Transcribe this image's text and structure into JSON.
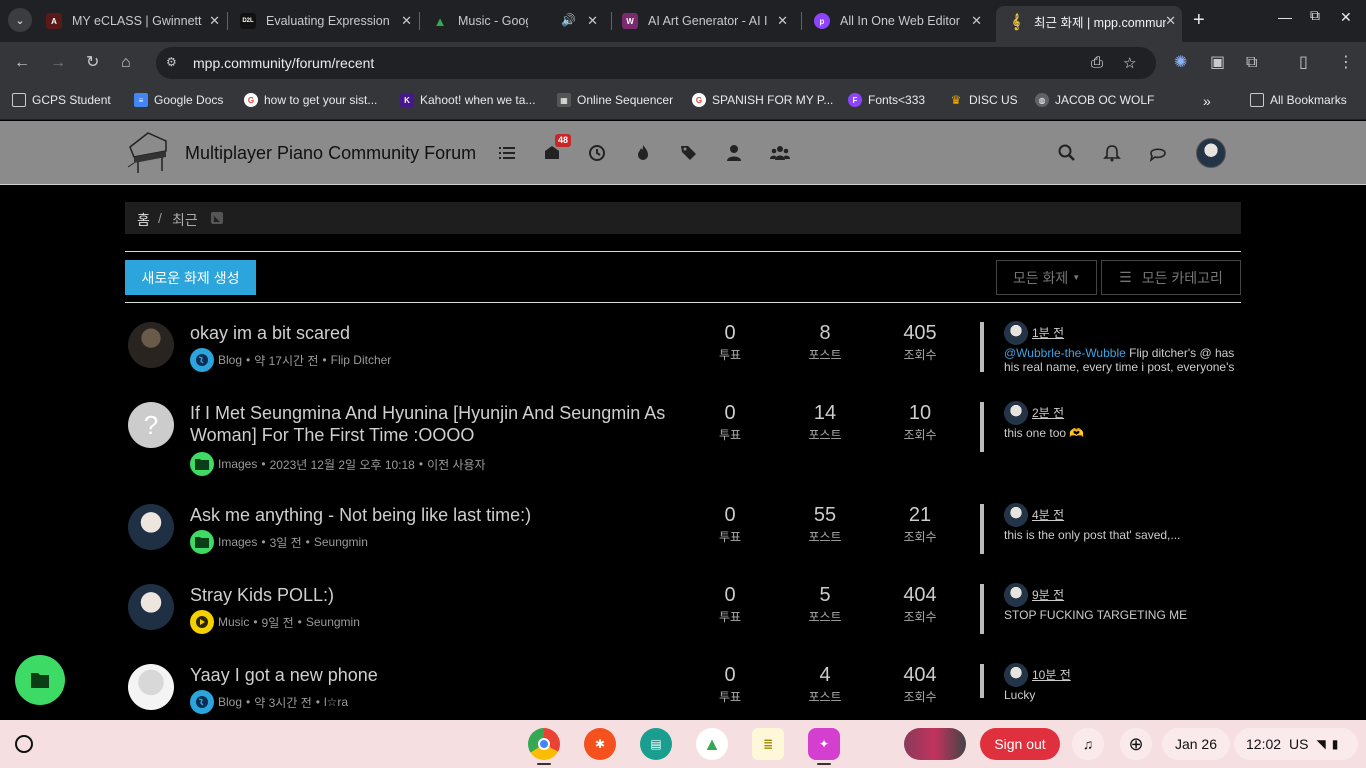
{
  "browser": {
    "tabs": [
      {
        "title": "MY eCLASS | Gwinnett",
        "fav_color": "#5a1a1a",
        "fav_text": "A"
      },
      {
        "title": "Evaluating Expression",
        "fav_color": "#111111",
        "fav_text": "D2L"
      },
      {
        "title": "Music - Google Drive",
        "fav_color": "#1e8e3e",
        "fav_text": "▲"
      },
      {
        "title": "AI Art Generator - AI Im",
        "fav_color": "#7a2b6e",
        "fav_text": "W"
      },
      {
        "title": "All In One Web Editor |",
        "fav_color": "#8e44ff",
        "fav_text": "p"
      },
      {
        "title": "최근 화제 | mpp.community",
        "fav_color": "#35363a",
        "fav_text": "𝄞"
      }
    ],
    "url": "mpp.community/forum/recent",
    "bookmarks": [
      {
        "label": "GCPS Student",
        "color": "#5f6368"
      },
      {
        "label": "Google Docs",
        "color": "#4285f4"
      },
      {
        "label": "how to get your sist...",
        "color": "#ea4335"
      },
      {
        "label": "Kahoot! when we ta...",
        "color": "#46178f"
      },
      {
        "label": "Online Sequencer",
        "color": "#555555"
      },
      {
        "label": "SPANISH FOR MY P...",
        "color": "#ea4335"
      },
      {
        "label": "Fonts<333",
        "color": "#8e44ff"
      },
      {
        "label": "DISC US",
        "color": "#f9ab00"
      },
      {
        "label": "JACOB OC WOLF",
        "color": "#5f6368"
      }
    ],
    "all_bookmarks": "All Bookmarks"
  },
  "site": {
    "title": "Multiplayer Piano Community Forum",
    "notification_count": "48"
  },
  "breadcrumb": {
    "home": "홈",
    "sep": "/",
    "current": "최근"
  },
  "actions": {
    "new_topic": "새로운 화제 생성",
    "filter_all": "모든 화제",
    "filter_categories": "모든 카테고리"
  },
  "topics": [
    {
      "title": "okay im a bit scared",
      "category": "Blog",
      "cat_color": "#2ba5dc",
      "cat_icon": "globe",
      "time": "약 17시간 전",
      "author": "Flip Ditcher",
      "votes": "0",
      "posts": "8",
      "views": "405",
      "teaser_time": "1분 전",
      "teaser_mention": "@Wubbrle-the-Wubble",
      "teaser_text": " Flip ditcher's @ has his real name, every time i post, everyone's",
      "avatar": "dark"
    },
    {
      "title": "If I Met Seungmina And Hyunina [Hyunjin And Seungmin As Woman] For The First Time :OOOO",
      "category": "Images",
      "cat_color": "#3ddb65",
      "cat_icon": "folder",
      "time": "2023년 12월 2일 오후 10:18",
      "author": "이전 사용자",
      "votes": "0",
      "posts": "14",
      "views": "10",
      "teaser_time": "2분 전",
      "teaser_mention": "",
      "teaser_text": "this one too 🫶",
      "avatar": "unknown"
    },
    {
      "title": "Ask me anything - Not being like last time:)",
      "category": "Images",
      "cat_color": "#3ddb65",
      "cat_icon": "folder",
      "time": "3일 전",
      "author": "Seungmin",
      "votes": "0",
      "posts": "55",
      "views": "21",
      "teaser_time": "4분 전",
      "teaser_mention": "",
      "teaser_text": "this is the only post that' saved,...",
      "avatar": "person"
    },
    {
      "title": "Stray Kids POLL:)",
      "category": "Music",
      "cat_color": "#f5d000",
      "cat_icon": "play",
      "time": "9일 전",
      "author": "Seungmin",
      "votes": "0",
      "posts": "5",
      "views": "404",
      "teaser_time": "9분 전",
      "teaser_mention": "",
      "teaser_text": "STOP FUCKING TARGETING ME",
      "avatar": "person"
    },
    {
      "title": "Yaay I got a new phone",
      "category": "Blog",
      "cat_color": "#2ba5dc",
      "cat_icon": "globe",
      "time": "약 3시간 전",
      "author": "l☆ra",
      "votes": "0",
      "posts": "4",
      "views": "404",
      "teaser_time": "10분 전",
      "teaser_mention": "",
      "teaser_text": "Lucky",
      "avatar": "light"
    }
  ],
  "labels": {
    "votes": "투표",
    "posts": "포스트",
    "views": "조회수",
    "bullet": "•"
  },
  "shelf": {
    "sign_out": "Sign out",
    "date": "Jan 26",
    "time": "12:02",
    "locale": "US"
  }
}
